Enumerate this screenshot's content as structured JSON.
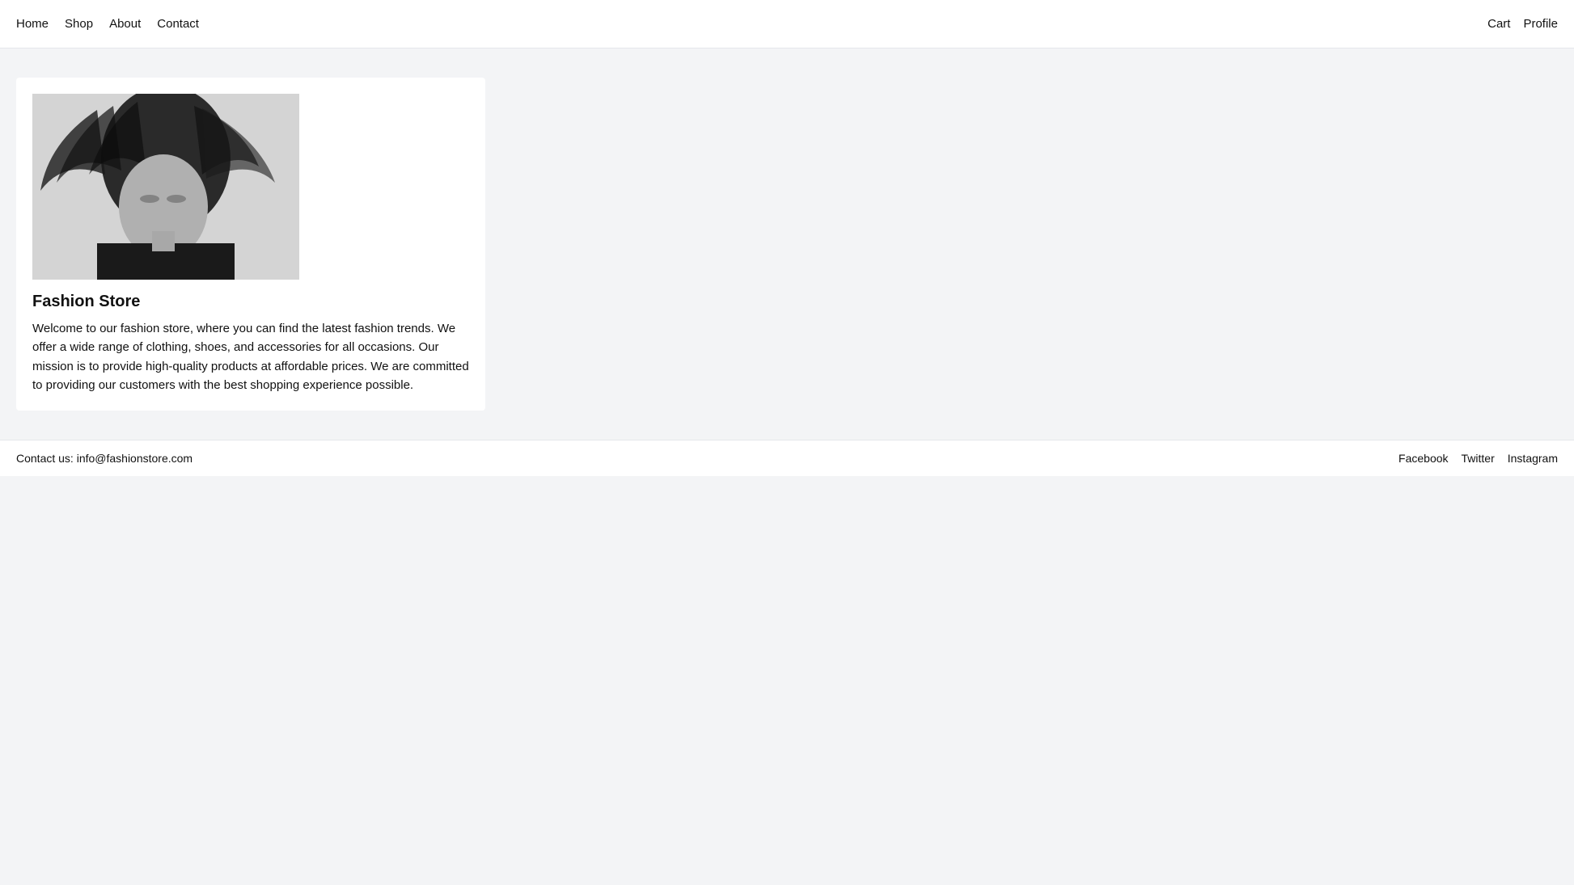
{
  "nav": {
    "left": [
      {
        "label": "Home",
        "href": "#"
      },
      {
        "label": "Shop",
        "href": "#"
      },
      {
        "label": "About",
        "href": "#"
      },
      {
        "label": "Contact",
        "href": "#"
      }
    ],
    "right": [
      {
        "label": "Cart",
        "href": "#"
      },
      {
        "label": "Profile",
        "href": "#"
      }
    ]
  },
  "card": {
    "title": "Fashion Store",
    "description": "Welcome to our fashion store, where you can find the latest fashion trends. We offer a wide range of clothing, shoes, and accessories for all occasions. Our mission is to provide high-quality products at affordable prices. We are committed to providing our customers with the best shopping experience possible."
  },
  "footer": {
    "contact": "Contact us: info@fashionstore.com",
    "social": [
      {
        "label": "Facebook",
        "href": "#"
      },
      {
        "label": "Twitter",
        "href": "#"
      },
      {
        "label": "Instagram",
        "href": "#"
      }
    ]
  }
}
